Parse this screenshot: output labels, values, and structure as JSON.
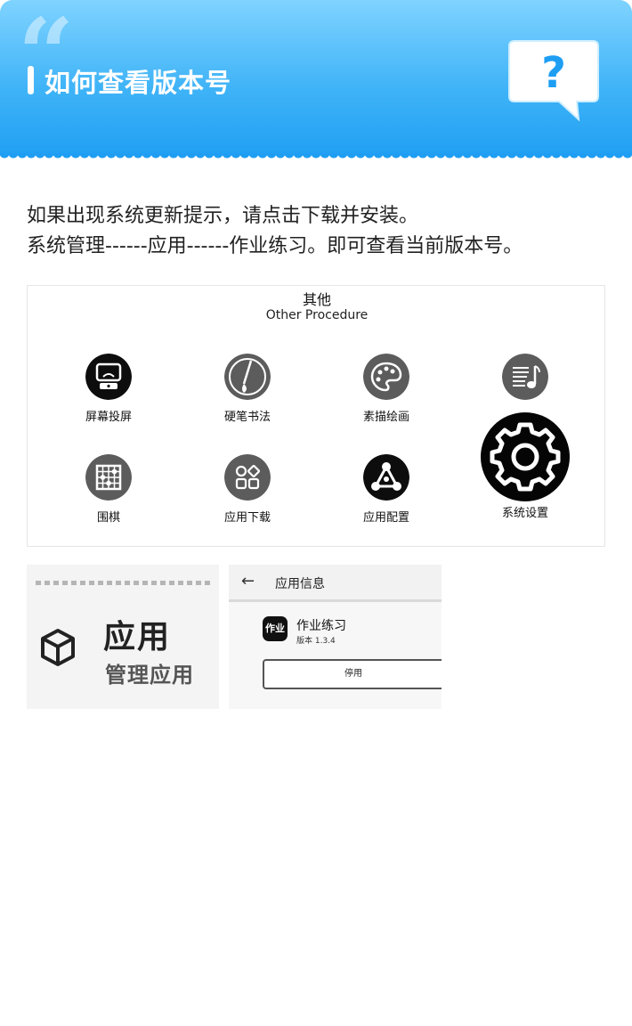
{
  "header": {
    "title": "如何查看版本号",
    "quote_glyph": "“",
    "help_icon": "question-bubble-icon",
    "gradient_top": "#7fd3ff",
    "gradient_bottom": "#1e9ef3"
  },
  "intro": {
    "line1": "如果出现系统更新提示，请点击下载并安装。",
    "line2": "系统管理------应用------作业练习。即可查看当前版本号。"
  },
  "panel": {
    "title": "其他",
    "subtitle": "Other Procedure",
    "apps": [
      {
        "label": "屏幕投屏",
        "icon": "screen-cast-icon"
      },
      {
        "label": "硬笔书法",
        "icon": "pen-calligraphy-icon"
      },
      {
        "label": "素描绘画",
        "icon": "palette-icon"
      },
      {
        "label": "",
        "icon": "music-notes-icon"
      },
      {
        "label": "围棋",
        "icon": "go-board-icon"
      },
      {
        "label": "应用下载",
        "icon": "app-grid-icon"
      },
      {
        "label": "应用配置",
        "icon": "share-nodes-icon"
      },
      {
        "label": "系统设置",
        "icon": "settings-gear-icon"
      }
    ]
  },
  "shot1": {
    "title": "应用",
    "subtitle": "管理应用",
    "icon": "cube-icon"
  },
  "shot2": {
    "back_glyph": "←",
    "header": "应用信息",
    "app_icon_text": "作业",
    "app_name": "作业练习",
    "version": "版本 1.3.4",
    "button": "停用"
  }
}
